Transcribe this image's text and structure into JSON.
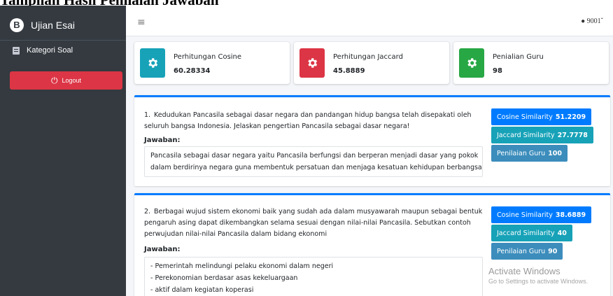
{
  "document_heading": "Tampilan Hasil Penilaian Jawaban",
  "sidebar": {
    "brand": "Ujian Esai",
    "brand_logo": "B",
    "nav_items": [
      {
        "label": "Kategori Soal",
        "icon": "list-alt-icon"
      }
    ],
    "logout_label": "Logout",
    "logout_icon": "⏻"
  },
  "topbar": {
    "menu_icon": "≡",
    "user_label": "9001"
  },
  "summary": [
    {
      "title": "Perhitungan Cosine",
      "value": "60.28334",
      "color": "#17a2b8"
    },
    {
      "title": "Perhitungan Jaccard",
      "value": "45.8889",
      "color": "#dc3545"
    },
    {
      "title": "Penialian Guru",
      "value": "98",
      "color": "#28a745"
    }
  ],
  "questions": [
    {
      "number": "1.",
      "text": "Kedudukan Pancasila sebagai dasar negara dan pandangan hidup bangsa telah disepakati oleh seluruh bangsa Indonesia. Jelaskan pengertian Pancasila sebagai dasar negara!",
      "answer_label": "Jawaban:",
      "answer_lines": [
        "Pancasila sebagai dasar negara yaitu Pancasila berfungsi dan berperan menjadi dasar yang pokok",
        "dalam berdirinya negara guna membentuk persatuan dan menjaga kesatuan kehidupan berbangsa"
      ],
      "scores": [
        {
          "label": "Cosine Similarity",
          "value": "51.2209",
          "color": "#007bff"
        },
        {
          "label": "Jaccard Similarity",
          "value": "27.7778",
          "color": "#17a2b8"
        },
        {
          "label": "Penilaian Guru",
          "value": "100",
          "color": "#3c8dbc"
        }
      ]
    },
    {
      "number": "2.",
      "text": "Berbagai wujud sistem ekonomi baik yang sudah ada dalam musyawarah maupun sebagai bentuk pengaruh asing dapat dikembangkan selama sesuai dengan nilai-nilai Pancasila. Sebutkan contoh perwujudan nilai-nilai Pancasila dalam bidang ekonomi",
      "answer_label": "Jawaban:",
      "answer_lines": [
        "- Pemerintah melindungi pelaku ekonomi dalam negeri",
        "- Perekonomian berdasar asas kekeluargaan",
        "- aktif dalam kegiatan koperasi"
      ],
      "scores": [
        {
          "label": "Cosine Similarity",
          "value": "38.6889",
          "color": "#007bff"
        },
        {
          "label": "Jaccard Similarity",
          "value": "40",
          "color": "#17a2b8"
        },
        {
          "label": "Penilaian Guru",
          "value": "90",
          "color": "#3c8dbc"
        }
      ]
    }
  ],
  "watermark": {
    "title": "Activate Windows",
    "subtitle": "Go to Settings to activate Windows."
  }
}
